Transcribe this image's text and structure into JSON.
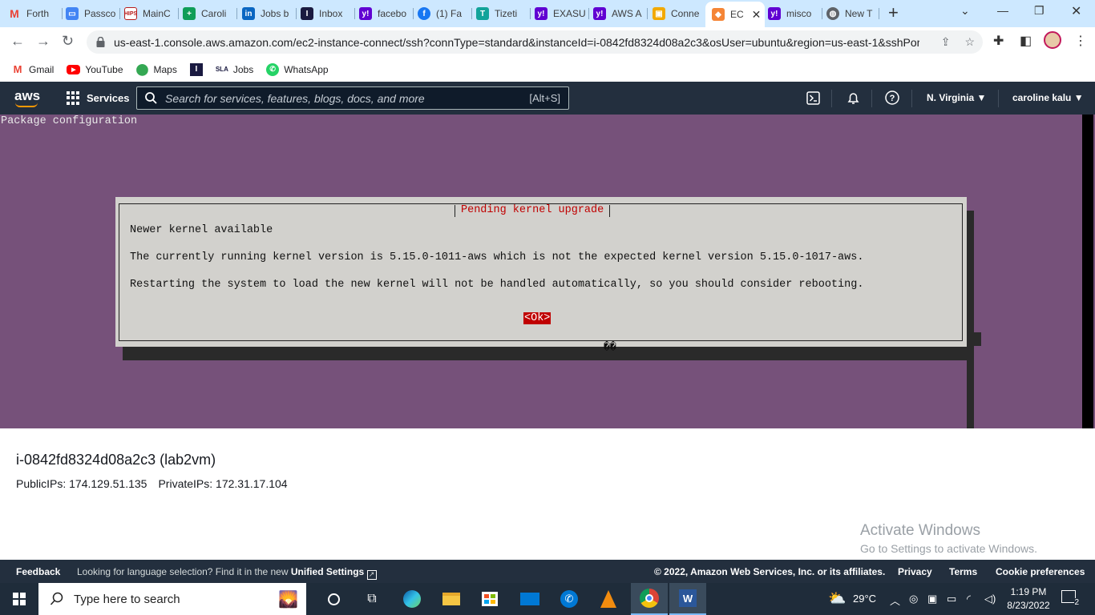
{
  "browser": {
    "tabs": [
      {
        "label": "Forth",
        "icon": "gmail-icon",
        "color": "#ea4335"
      },
      {
        "label": "Passco",
        "icon": "passcode-icon",
        "color": "#4285f4"
      },
      {
        "label": "MainC",
        "icon": "hips-icon",
        "color": "#b71c1c"
      },
      {
        "label": "Caroli",
        "icon": "sheets-icon",
        "color": "#0f9d58"
      },
      {
        "label": "Jobs b",
        "icon": "linkedin-icon",
        "color": "#0a66c2"
      },
      {
        "label": "Inbox",
        "icon": "indeed-icon",
        "color": "#1a1a40"
      },
      {
        "label": "facebo",
        "icon": "yahoo-icon",
        "color": "#6001d2"
      },
      {
        "label": "(1) Fa",
        "icon": "facebook-icon",
        "color": "#1877f2"
      },
      {
        "label": "Tizeti",
        "icon": "tizeti-icon",
        "color": "#12a39a"
      },
      {
        "label": "EXASU",
        "icon": "yahoo-icon",
        "color": "#6001d2"
      },
      {
        "label": "AWS A",
        "icon": "yahoo-icon",
        "color": "#6001d2"
      },
      {
        "label": "Conne",
        "icon": "aws-cube-icon",
        "color": "#f2a900"
      },
      {
        "label": "EC",
        "icon": "ec2-icon",
        "color": "#f58536",
        "active": true
      },
      {
        "label": "misco",
        "icon": "yahoo-icon",
        "color": "#6001d2"
      },
      {
        "label": "New T",
        "icon": "globe-icon",
        "color": "#5f6368"
      }
    ],
    "url": "us-east-1.console.aws.amazon.com/ec2-instance-connect/ssh?connType=standard&instanceId=i-0842fd8324d08a2c3&osUser=ubuntu&region=us-east-1&sshPor...",
    "bookmarks": [
      {
        "label": "Gmail",
        "icon": "gmail-icon"
      },
      {
        "label": "YouTube",
        "icon": "youtube-icon"
      },
      {
        "label": "Maps",
        "icon": "maps-icon"
      },
      {
        "label": "",
        "icon": "indeed-icon"
      },
      {
        "label": "Jobs",
        "icon": "sla-icon"
      },
      {
        "label": "WhatsApp",
        "icon": "whatsapp-icon"
      }
    ]
  },
  "aws_nav": {
    "logo": "aws",
    "services": "Services",
    "search_placeholder": "Search for services, features, blogs, docs, and more",
    "search_shortcut": "[Alt+S]",
    "region": "N. Virginia",
    "user": "caroline kalu"
  },
  "terminal": {
    "title": "Package configuration",
    "dialog": {
      "title": "Pending kernel upgrade",
      "line1": "Newer kernel available",
      "line2": "The currently running kernel version is 5.15.0-1011-aws which is not the expected kernel version 5.15.0-1017-aws.",
      "line3": "Restarting the system to load the new kernel will not be handled automatically, so you should consider rebooting.",
      "ok": "<Ok>",
      "garble": "��"
    }
  },
  "instance": {
    "title": "i-0842fd8324d08a2c3 (lab2vm)",
    "public_ips": "PublicIPs: 174.129.51.135",
    "private_ips": "PrivateIPs: 172.31.17.104"
  },
  "watermark": {
    "line1": "Activate Windows",
    "line2": "Go to Settings to activate Windows."
  },
  "footer": {
    "feedback": "Feedback",
    "lang_text": "Looking for language selection? Find it in the new",
    "lang_link": "Unified Settings",
    "copyright": "© 2022, Amazon Web Services, Inc. or its affiliates.",
    "privacy": "Privacy",
    "terms": "Terms",
    "cookies": "Cookie preferences"
  },
  "taskbar": {
    "search_placeholder": "Type here to search",
    "weather": "29°C",
    "time": "1:19 PM",
    "date": "8/23/2022",
    "notifications": "2"
  }
}
